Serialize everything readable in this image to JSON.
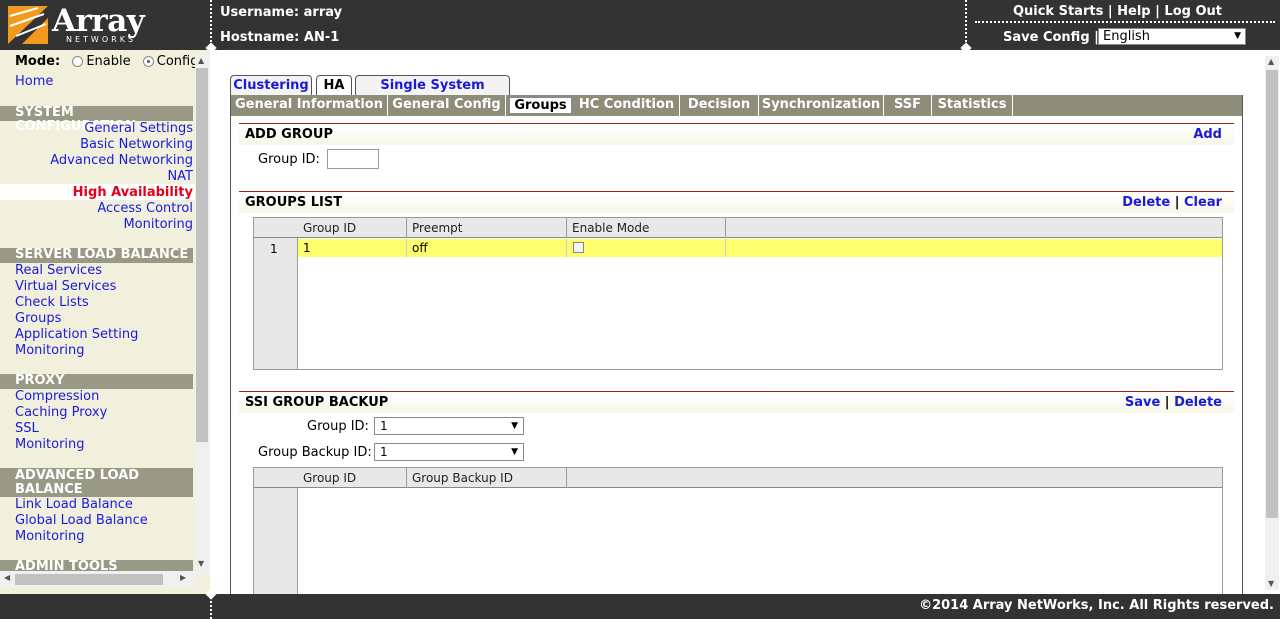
{
  "header": {
    "logo_word": "Array",
    "logo_sub": "NETWORKS",
    "username_label": "Username: array",
    "hostname_label": "Hostname: AN-1",
    "quick_starts": "Quick Starts",
    "help": "Help",
    "logout": "Log Out",
    "sep": "|",
    "save_config": "Save Config |",
    "language": "English"
  },
  "sidebar": {
    "mode_label": "Mode:",
    "mode_enable": "Enable",
    "mode_config": "Config",
    "home": "Home",
    "system_config": {
      "title": "SYSTEM CONFIGURATION",
      "items": [
        "General Settings",
        "Basic Networking",
        "Advanced Networking",
        "NAT",
        "High Availability",
        "Access Control",
        "Monitoring"
      ]
    },
    "slb": {
      "title": "SERVER LOAD BALANCE",
      "items": [
        "Real Services",
        "Virtual Services",
        "Check Lists",
        "Groups",
        "Application Setting",
        "Monitoring"
      ]
    },
    "proxy": {
      "title": "PROXY",
      "items": [
        "Compression",
        "Caching Proxy",
        "SSL",
        "Monitoring"
      ]
    },
    "alb": {
      "title_line1": "ADVANCED LOAD",
      "title_line2": "BALANCE",
      "items": [
        "Link Load Balance",
        "Global Load Balance",
        "Monitoring"
      ]
    },
    "admin_tools": "ADMIN TOOLS"
  },
  "tabs_primary": [
    "Clustering",
    "HA",
    "Single System Image"
  ],
  "tabs_secondary": [
    "General Information",
    "General Config",
    "Groups",
    "HC Condition",
    "Decision",
    "Synchronization",
    "SSF",
    "Statistics"
  ],
  "add_group": {
    "title": "ADD GROUP",
    "add_link": "Add",
    "group_id_label": "Group ID:",
    "group_id_value": ""
  },
  "groups_list": {
    "title": "GROUPS LIST",
    "delete_link": "Delete",
    "clear_link": "Clear",
    "sep": "|",
    "columns": [
      "Group ID",
      "Preempt",
      "Enable Mode"
    ],
    "rows": [
      {
        "num": "1",
        "group_id": "1",
        "preempt": "off"
      }
    ]
  },
  "ssi_backup": {
    "title": "SSI GROUP BACKUP",
    "save_link": "Save",
    "delete_link": "Delete",
    "sep": "|",
    "group_id_label": "Group ID:",
    "group_id_value": "1",
    "backup_id_label": "Group Backup ID:",
    "backup_id_value": "1",
    "columns": [
      "Group ID",
      "Group Backup ID"
    ]
  },
  "footer": {
    "copyright": "©2014 Array NetWorks, Inc. All Rights reserved."
  },
  "colors": {
    "topbar": "#333333",
    "sidebar_bg": "#f1f0dc",
    "section_bar": "#999a86",
    "link": "#1a1adb",
    "active_link": "#e5001b",
    "row_highlight": "#fefe6e"
  }
}
